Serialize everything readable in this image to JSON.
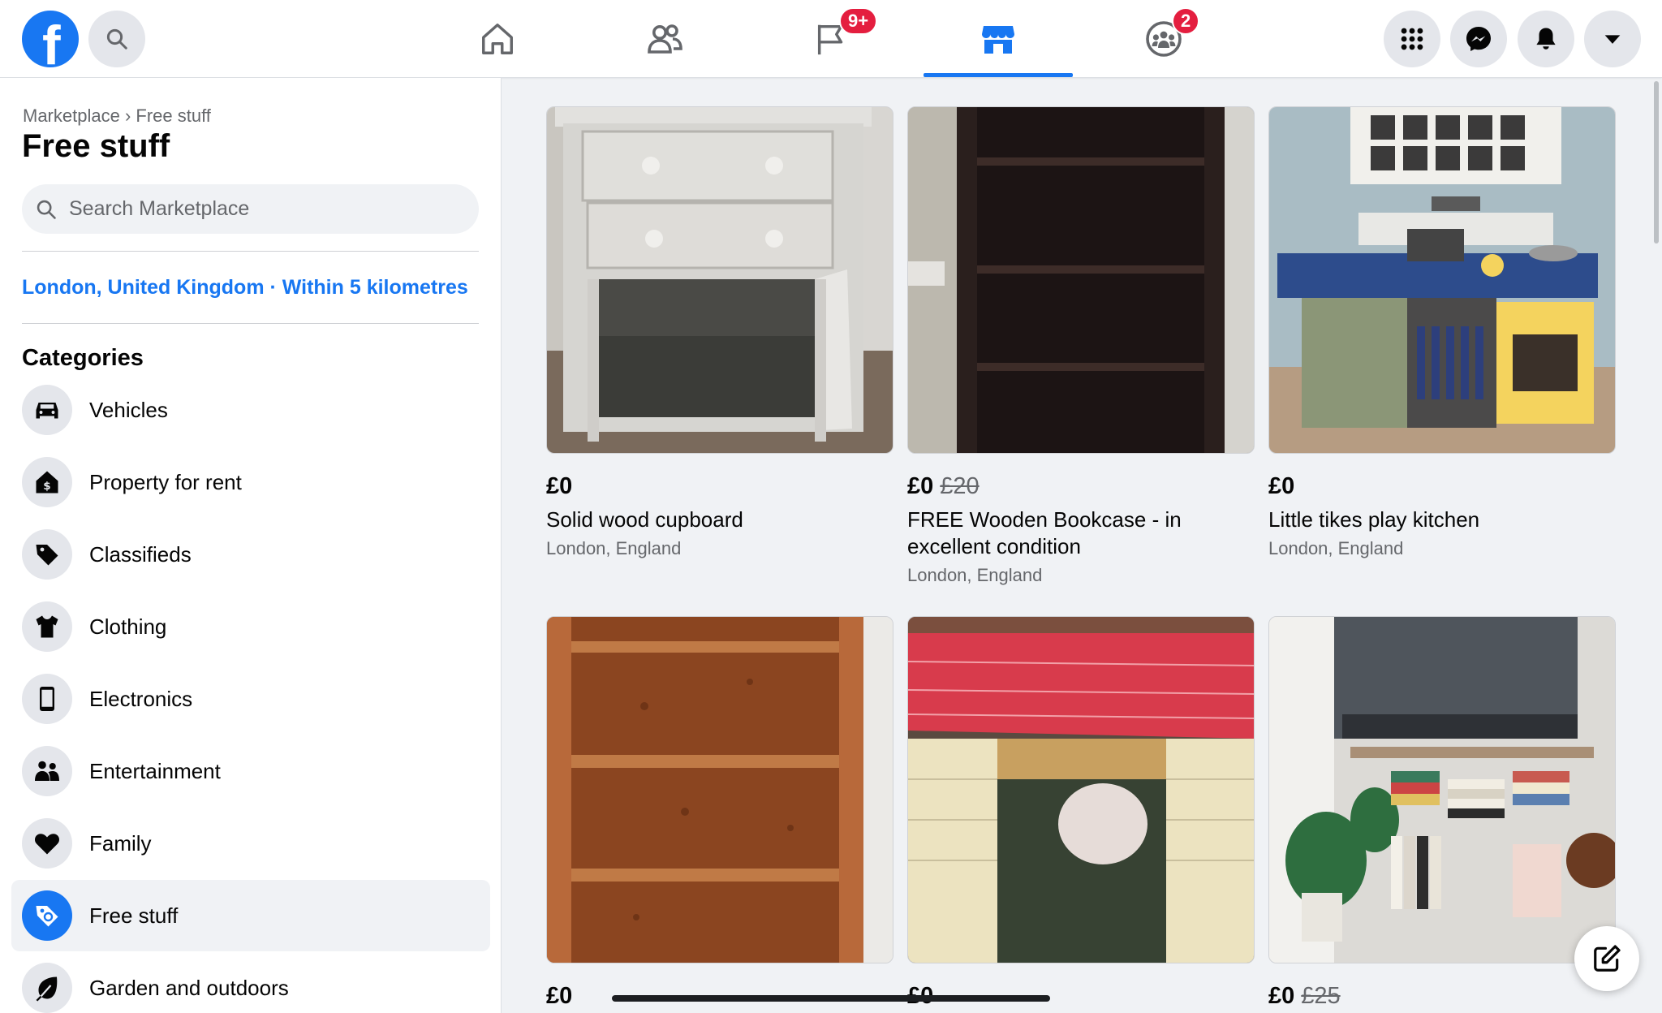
{
  "topbar": {
    "logo_letter": "f",
    "search_icon": "search-icon",
    "nav": [
      {
        "name": "home",
        "icon": "home-icon"
      },
      {
        "name": "friends",
        "icon": "friends-icon"
      },
      {
        "name": "pages",
        "icon": "flag-icon",
        "badge": "9+"
      },
      {
        "name": "marketplace",
        "icon": "marketplace-icon",
        "active": true
      },
      {
        "name": "groups",
        "icon": "groups-icon",
        "badge": "2"
      }
    ],
    "right_icons": [
      "menu-grid-icon",
      "messenger-icon",
      "bell-icon",
      "caret-down-icon"
    ]
  },
  "sidebar": {
    "breadcrumb": "Marketplace › Free stuff",
    "title": "Free stuff",
    "search_placeholder": "Search Marketplace",
    "location": "London, United Kingdom · Within 5 kilometres",
    "categories_title": "Categories",
    "categories": [
      {
        "label": "Vehicles",
        "icon": "car-icon"
      },
      {
        "label": "Property for rent",
        "icon": "house-icon"
      },
      {
        "label": "Classifieds",
        "icon": "tag-icon"
      },
      {
        "label": "Clothing",
        "icon": "shirt-icon"
      },
      {
        "label": "Electronics",
        "icon": "phone-icon"
      },
      {
        "label": "Entertainment",
        "icon": "people-icon"
      },
      {
        "label": "Family",
        "icon": "heart-icon"
      },
      {
        "label": "Free stuff",
        "icon": "free-tag-icon",
        "active": true
      },
      {
        "label": "Garden and outdoors",
        "icon": "leaf-icon"
      }
    ]
  },
  "listings": [
    {
      "price": "£0",
      "old_price": "",
      "title": "Solid wood cupboard",
      "location": "London, England"
    },
    {
      "price": "£0",
      "old_price": "£20",
      "title": "FREE Wooden Bookcase - in excellent condition",
      "location": "London, England"
    },
    {
      "price": "£0",
      "old_price": "",
      "title": "Little tikes play kitchen",
      "location": "London, England"
    },
    {
      "price": "£0",
      "old_price": "",
      "title": "",
      "location": ""
    },
    {
      "price": "£0",
      "old_price": "",
      "title": "",
      "location": ""
    },
    {
      "price": "£0",
      "old_price": "£25",
      "title": "",
      "location": ""
    }
  ],
  "colors": {
    "brand": "#1877f2",
    "badge": "#e41e3f",
    "link": "#1877f2"
  }
}
